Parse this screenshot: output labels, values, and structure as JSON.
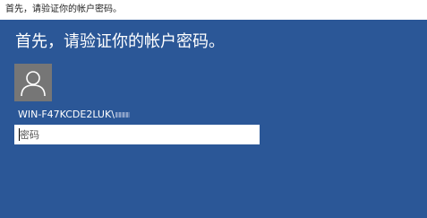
{
  "window": {
    "title": "首先，请验证你的帐户密码。"
  },
  "main": {
    "heading": "首先，请验证你的帐户密码。",
    "account": {
      "avatar_icon": "user-silhouette-icon",
      "username": "WIN-F47KCDE2LUK\\"
    },
    "password_field": {
      "placeholder": "密码",
      "value": ""
    }
  },
  "colors": {
    "background": "#2b5797",
    "avatar_bg": "#767676",
    "text": "#ffffff"
  }
}
